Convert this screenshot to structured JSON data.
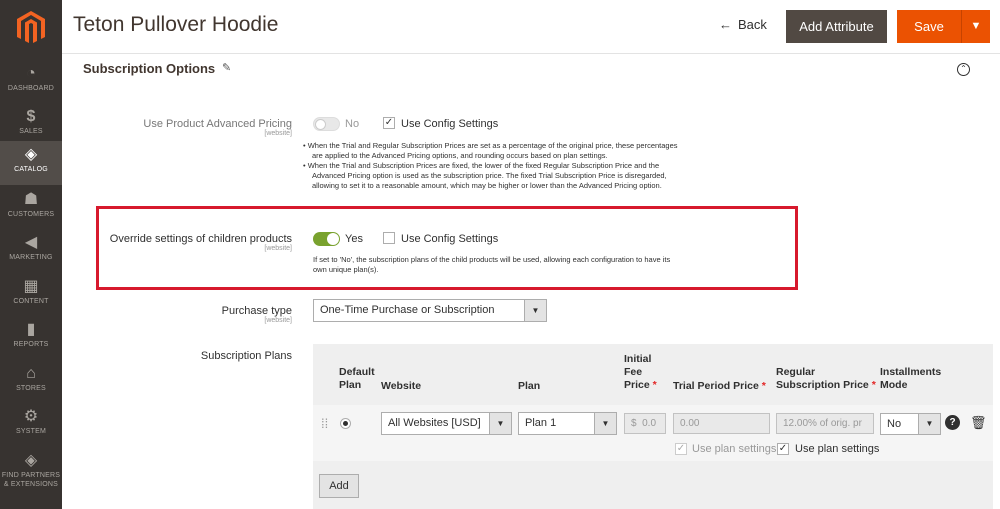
{
  "sidebar": {
    "items": [
      {
        "label": "DASHBOARD",
        "icon": "dashboard-icon",
        "glyph": "◔"
      },
      {
        "label": "SALES",
        "icon": "dollar-icon",
        "glyph": "$"
      },
      {
        "label": "CATALOG",
        "icon": "cube-icon",
        "glyph": "◈"
      },
      {
        "label": "CUSTOMERS",
        "icon": "person-icon",
        "glyph": "☗"
      },
      {
        "label": "MARKETING",
        "icon": "megaphone-icon",
        "glyph": "◀"
      },
      {
        "label": "CONTENT",
        "icon": "content-icon",
        "glyph": "▦"
      },
      {
        "label": "REPORTS",
        "icon": "bar-chart-icon",
        "glyph": "▮"
      },
      {
        "label": "STORES",
        "icon": "store-icon",
        "glyph": "⌂"
      },
      {
        "label": "SYSTEM",
        "icon": "gear-icon",
        "glyph": "⚙"
      },
      {
        "label_line1": "FIND PARTNERS",
        "label_line2": "& EXTENSIONS",
        "icon": "partners-icon",
        "glyph": "◈"
      }
    ]
  },
  "header": {
    "title": "Teton Pullover Hoodie",
    "back": "Back",
    "add_attribute": "Add Attribute",
    "save": "Save"
  },
  "section": {
    "title": "Subscription Options"
  },
  "advanced_pricing": {
    "label": "Use Product Advanced Pricing",
    "scope": "[website]",
    "toggle_state": "No",
    "use_config": "Use Config Settings",
    "note_1a": "When the Trial and Regular Subscription Prices are set as a percentage of the original price, these percentages",
    "note_1b": "are applied to the Advanced Pricing options, and rounding occurs based on plan settings.",
    "note_2a": "When the Trial and Subscription Prices are fixed, the lower of the fixed Regular Subscription Price and the",
    "note_2b": "Advanced Pricing option is used as the subscription price. The fixed Trial Subscription Price is disregarded,",
    "note_2c": "allowing to set it to a reasonable amount, which may be higher or lower than the Advanced Pricing option."
  },
  "override": {
    "label": "Override settings of children products",
    "scope": "[website]",
    "toggle_state": "Yes",
    "use_config": "Use Config Settings",
    "note_a": "If set to 'No', the subscription plans of the child products will be used, allowing each configuration to have its",
    "note_b": "own unique plan(s)."
  },
  "purchase_type": {
    "label": "Purchase type",
    "scope": "[website]",
    "value": "One-Time Purchase or Subscription"
  },
  "plans": {
    "label": "Subscription Plans",
    "headers": {
      "default_1": "Default",
      "default_2": "Plan",
      "website": "Website",
      "plan": "Plan",
      "initial_1": "Initial",
      "initial_2": "Fee",
      "initial_3": "Price",
      "trial": "Trial Period Price",
      "regular_1": "Regular",
      "regular_2": "Subscription Price",
      "installments_1": "Installments",
      "installments_2": "Mode",
      "required_mark": "*"
    },
    "row": {
      "website": "All Websites [USD]",
      "plan": "Plan 1",
      "currency": "$",
      "initial_fee": "0.0",
      "trial_price": "0.00",
      "regular_price": "12.00% of orig. pr",
      "installments": "No",
      "use_plan_settings_trial": "Use plan settings",
      "use_plan_settings_regular": "Use plan settings"
    },
    "add_button": "Add"
  }
}
